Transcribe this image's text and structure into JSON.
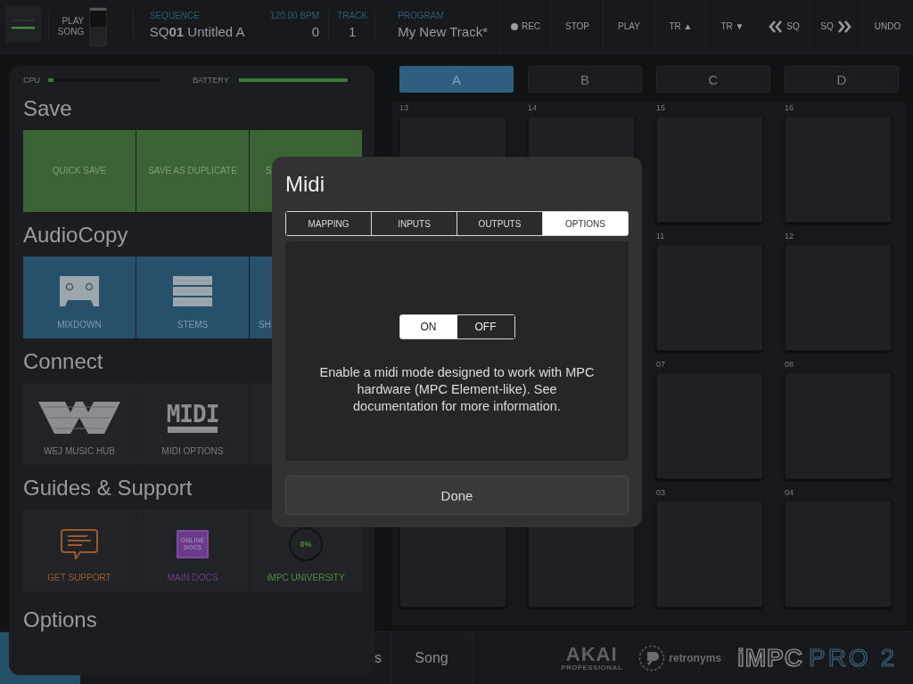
{
  "top_bar": {
    "play_song": {
      "label_1": "PLAY",
      "label_2": "SONG",
      "on": false
    },
    "sequence": {
      "label": "SEQUENCE",
      "value": "SQ**01** Untitled A"
    },
    "tempo": {
      "label": "120.00 BPM",
      "value": "0"
    },
    "track": {
      "label": "TRACK",
      "value": "1"
    },
    "program": {
      "label": "PROGRAM",
      "value": "My New Track*"
    },
    "buttons": [
      {
        "label": "REC"
      },
      {
        "label": "STOP"
      },
      {
        "label": "PLAY"
      },
      {
        "label": "TR ▲"
      },
      {
        "label": "TR ▼"
      },
      {
        "label": "SQ"
      },
      {
        "label": "SQ"
      },
      {
        "label": "UNDO"
      }
    ]
  },
  "pad_banks": [
    {
      "label": "A",
      "selected": true
    },
    {
      "label": "B",
      "selected": false
    },
    {
      "label": "C",
      "selected": false
    },
    {
      "label": "D",
      "selected": false
    }
  ],
  "pad_rows": [
    {
      "labels": [
        "13",
        "14",
        "15",
        "16"
      ]
    },
    {
      "labels": [
        "11",
        "12"
      ]
    },
    {
      "labels": [
        "07",
        "08"
      ]
    },
    {
      "labels": [
        "03",
        "04"
      ]
    }
  ],
  "bottom_tabs": [
    {
      "label": "s"
    },
    {
      "label": "Song"
    }
  ],
  "logos": {
    "akai": "AKAI",
    "akai_sub": "PROFESSIONAL",
    "retronyms": "retronyms",
    "impc": "iMPC",
    "pro": "PRO 2"
  },
  "panel": {
    "cpu": {
      "label": "CPU",
      "level": 0.05
    },
    "battery": {
      "label": "BATTERY",
      "level": 0.97
    },
    "sections": [
      {
        "title": "Save",
        "kind": "save",
        "tiles": [
          {
            "label": "QUICK SAVE"
          },
          {
            "label": "SAVE AS DUPLICATE"
          },
          {
            "label": "S"
          }
        ]
      },
      {
        "title": "AudioCopy",
        "kind": "audiocopy",
        "tiles": [
          {
            "label": "MIXDOWN"
          },
          {
            "label": "STEMS"
          },
          {
            "label": "SH"
          }
        ]
      },
      {
        "title": "Connect",
        "kind": "connect",
        "tiles": [
          {
            "label": "WEJ MUSIC HUB"
          },
          {
            "label": "MIDI OPTIONS",
            "icon_text": "MIDI"
          }
        ]
      },
      {
        "title": "Guides & Support",
        "kind": "guides",
        "tiles": [
          {
            "label": "GET SUPPORT",
            "color": "#9a5a2c"
          },
          {
            "label": "MAIN DOCS",
            "icon_text": "ONLINE DOCS",
            "color": "#6c3a8a"
          },
          {
            "label": "iMPC UNIVERSITY",
            "icon_text": "0%",
            "color": "#4f8a43"
          }
        ]
      },
      {
        "title": "Options",
        "kind": "options"
      }
    ]
  },
  "dialog": {
    "title": "Midi",
    "tabs": [
      {
        "label": "MAPPING",
        "selected": false
      },
      {
        "label": "INPUTS",
        "selected": false
      },
      {
        "label": "OUTPUTS",
        "selected": false
      },
      {
        "label": "OPTIONS",
        "selected": true
      }
    ],
    "toggle": [
      {
        "label": "ON",
        "selected": true
      },
      {
        "label": "OFF",
        "selected": false
      }
    ],
    "description": "Enable a midi mode designed to work with MPC hardware (MPC Element-like). See documentation for more information.",
    "done": "Done"
  }
}
